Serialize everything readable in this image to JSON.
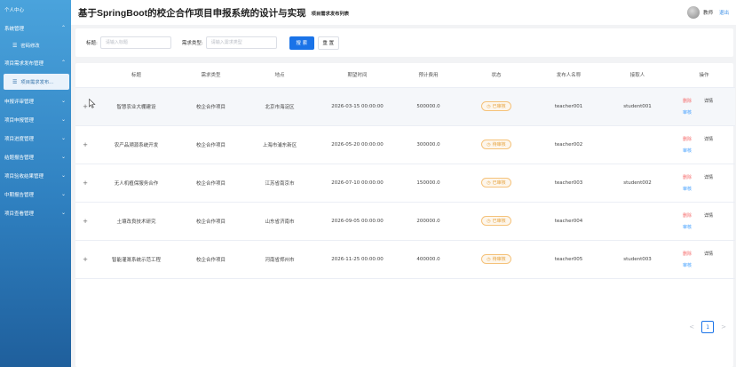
{
  "header": {
    "app_title": "基于SpringBoot的校企合作项目申报系统的设计与实现",
    "breadcrumb": "项目需求发布列表",
    "username": "教师",
    "logout": "退出"
  },
  "sidebar": {
    "items": [
      {
        "label": "个人中心",
        "chevron": ""
      },
      {
        "label": "系统管理",
        "chevron": "^"
      },
      {
        "label": "密码修改",
        "sub": true
      },
      {
        "label": "项目需求发布管理",
        "chevron": "^"
      },
      {
        "label": "项目需求发布...",
        "sub": true,
        "active": true
      },
      {
        "label": "申报评审管理",
        "chevron": "v"
      },
      {
        "label": "项目申报管理",
        "chevron": "v"
      },
      {
        "label": "项目进度管理",
        "chevron": "v"
      },
      {
        "label": "结题报告管理",
        "chevron": "v"
      },
      {
        "label": "项目验收结果管理",
        "chevron": "v"
      },
      {
        "label": "中期报告管理",
        "chevron": "v"
      },
      {
        "label": "项目查看管理",
        "chevron": "v"
      }
    ]
  },
  "search": {
    "title_label": "标题:",
    "title_placeholder": "请输入标题",
    "type_label": "需求类型:",
    "type_placeholder": "请输入需求类型",
    "search_button": "搜 索",
    "reset_button": "重 置"
  },
  "table": {
    "columns": [
      "",
      "标题",
      "需求类型",
      "地点",
      "期望时间",
      "预计费用",
      "状态",
      "发布人名称",
      "接取人",
      "操作"
    ],
    "rows": [
      {
        "title": "智慧农业大棚建设",
        "type": "校企合作项目",
        "location": "北京市海淀区",
        "time": "2026-03-15 00:00:00",
        "cost": "500000.0",
        "status": "已审核",
        "publisher": "teacher001",
        "receiver": "student001"
      },
      {
        "title": "农产品溯源系统开发",
        "type": "校企合作项目",
        "location": "上海市浦东新区",
        "time": "2026-05-20 00:00:00",
        "cost": "300000.0",
        "status": "待审核",
        "publisher": "teacher002",
        "receiver": ""
      },
      {
        "title": "无人机植保服务合作",
        "type": "校企合作项目",
        "location": "江苏省南京市",
        "time": "2026-07-10 00:00:00",
        "cost": "150000.0",
        "status": "已审核",
        "publisher": "teacher003",
        "receiver": "student002"
      },
      {
        "title": "土壤改良技术研究",
        "type": "校企合作项目",
        "location": "山东省济南市",
        "time": "2026-09-05 00:00:00",
        "cost": "200000.0",
        "status": "已审核",
        "publisher": "teacher004",
        "receiver": ""
      },
      {
        "title": "智能灌溉系统示范工程",
        "type": "校企合作项目",
        "location": "河南省郑州市",
        "time": "2026-11-25 00:00:00",
        "cost": "400000.0",
        "status": "待审核",
        "publisher": "teacher005",
        "receiver": "student003"
      }
    ],
    "actions": {
      "delete": "删除",
      "detail": "详情",
      "audit": "审核"
    }
  },
  "pagination": {
    "prev": "<",
    "current": "1",
    "next": ">"
  },
  "colors": {
    "primary": "#1a73e8",
    "danger": "#f56c6c",
    "warning": "#e6a23c",
    "sidebar_top": "#4aa3dc",
    "sidebar_bottom": "#1f5f9c"
  }
}
